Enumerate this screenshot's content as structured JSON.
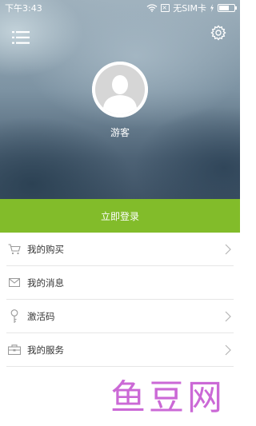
{
  "statusbar": {
    "time": "下午3:43",
    "sim_text": "无SIM卡",
    "icons": [
      "wifi-icon",
      "no-sim-icon",
      "charging-icon",
      "battery-icon"
    ]
  },
  "header": {
    "username": "游客",
    "icons": [
      "menu-icon",
      "gear-icon",
      "avatar-silhouette"
    ]
  },
  "login": {
    "label": "立即登录",
    "color": "#82bc2a"
  },
  "menu": {
    "items": [
      {
        "label": "我的购买",
        "icon": "cart-icon"
      },
      {
        "label": "我的消息",
        "icon": "mail-icon"
      },
      {
        "label": "激活码",
        "icon": "key-icon"
      },
      {
        "label": "我的服务",
        "icon": "briefcase-icon"
      }
    ]
  },
  "watermark": {
    "text": "鱼豆网"
  }
}
